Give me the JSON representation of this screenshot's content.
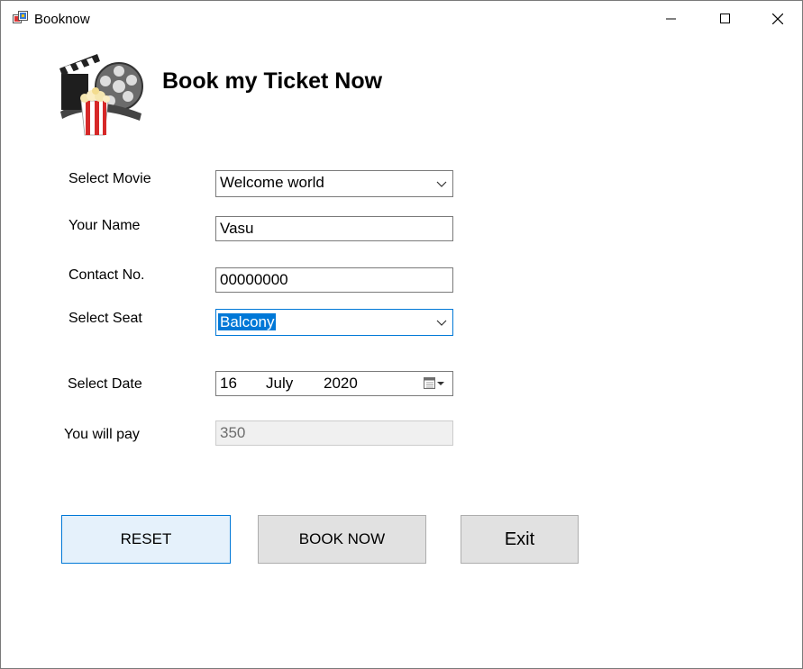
{
  "window": {
    "title": "Booknow"
  },
  "header": {
    "heading": "Book my Ticket Now"
  },
  "form": {
    "movie_label": "Select Movie",
    "movie_value": "Welcome world",
    "name_label": "Your Name",
    "name_value": "Vasu",
    "contact_label": "Contact No.",
    "contact_value": "00000000",
    "seat_label": "Select Seat",
    "seat_value": "Balcony",
    "date_label": "Select Date",
    "date_day": "16",
    "date_month": "July",
    "date_year": "2020",
    "pay_label": "You will pay",
    "pay_value": "350"
  },
  "buttons": {
    "reset": "RESET",
    "book": "BOOK NOW",
    "exit": "Exit"
  },
  "colors": {
    "accent": "#0078d7",
    "button_bg": "#e1e1e1",
    "default_button_bg": "#e5f1fb"
  },
  "icons": [
    "app-icon",
    "minimize-icon",
    "maximize-icon",
    "close-icon",
    "movie-clapper-popcorn-logo",
    "chevron-down-icon",
    "calendar-icon"
  ]
}
